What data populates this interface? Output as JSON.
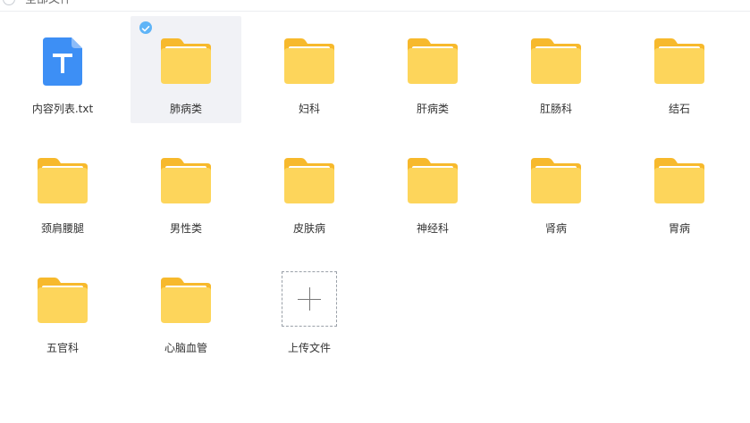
{
  "header": {
    "title": "全部文件"
  },
  "colors": {
    "folder_back": "#f7b92c",
    "folder_front": "#fdd55b",
    "folder_paper": "#ffffff",
    "txt_icon": "#3d8ff5",
    "selected_bg": "#f1f2f6",
    "check": "#5fb4f7"
  },
  "items": [
    {
      "label": "内容列表.txt",
      "icon": "txt-file-icon",
      "selected": false
    },
    {
      "label": "肺病类",
      "icon": "folder-icon",
      "selected": true
    },
    {
      "label": "妇科",
      "icon": "folder-icon",
      "selected": false
    },
    {
      "label": "肝病类",
      "icon": "folder-icon",
      "selected": false
    },
    {
      "label": "肛肠科",
      "icon": "folder-icon",
      "selected": false
    },
    {
      "label": "结石",
      "icon": "folder-icon",
      "selected": false
    },
    {
      "label": "颈肩腰腿",
      "icon": "folder-icon",
      "selected": false
    },
    {
      "label": "男性类",
      "icon": "folder-icon",
      "selected": false
    },
    {
      "label": "皮肤病",
      "icon": "folder-icon",
      "selected": false
    },
    {
      "label": "神经科",
      "icon": "folder-icon",
      "selected": false
    },
    {
      "label": "肾病",
      "icon": "folder-icon",
      "selected": false
    },
    {
      "label": "胃病",
      "icon": "folder-icon",
      "selected": false
    },
    {
      "label": "五官科",
      "icon": "folder-icon",
      "selected": false
    },
    {
      "label": "心脑血管",
      "icon": "folder-icon",
      "selected": false
    }
  ],
  "upload": {
    "label": "上传文件",
    "icon": "plus-icon"
  }
}
